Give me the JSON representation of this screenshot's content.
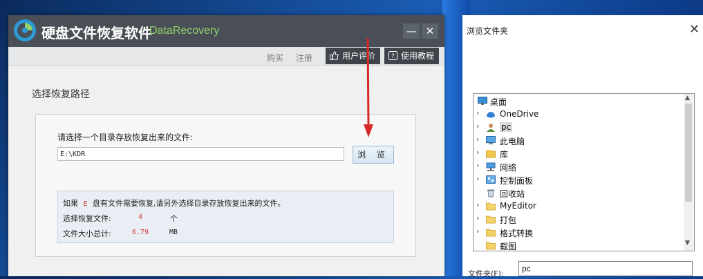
{
  "app": {
    "title_cn": "硬盘文件恢复软件",
    "title_en": "DataRecovery",
    "minimize_symbol": "—",
    "close_symbol": "✕"
  },
  "toolbar": {
    "buy_label": "购买",
    "register_label": "注册",
    "review_label": "用户评价",
    "tutorial_label": "使用教程"
  },
  "main": {
    "section_title": "选择恢复路径",
    "prompt": "请选择一个目录存放恢复出来的文件:",
    "path_value": "E:\\KDR",
    "browse_label": "浏 览",
    "info": {
      "line1_prefix": "如果",
      "drive": "E",
      "line1_suffix": "盘有文件需要恢复,请另外选择目录存放恢复出来的文件。",
      "files_label": "选择恢复文件:",
      "files_count": "4",
      "files_unit": "个",
      "size_label": "文件大小总计:",
      "size_value": "6.79",
      "size_unit": "MB"
    }
  },
  "dialog": {
    "title": "浏览文件夹",
    "close_symbol": "✕",
    "tree": [
      {
        "label": "桌面",
        "icon": "desktop-icon",
        "expandable": false
      },
      {
        "label": "OneDrive",
        "icon": "cloud-icon",
        "expandable": true
      },
      {
        "label": "pc",
        "icon": "user-icon",
        "expandable": true,
        "selected": true
      },
      {
        "label": "此电脑",
        "icon": "computer-icon",
        "expandable": true
      },
      {
        "label": "库",
        "icon": "library-icon",
        "expandable": true
      },
      {
        "label": "网络",
        "icon": "network-icon",
        "expandable": true
      },
      {
        "label": "控制面板",
        "icon": "control-panel-icon",
        "expandable": true
      },
      {
        "label": "回收站",
        "icon": "recycle-bin-icon",
        "expandable": false
      },
      {
        "label": "MyEditor",
        "icon": "folder-icon",
        "expandable": true
      },
      {
        "label": "打包",
        "icon": "folder-icon",
        "expandable": true
      },
      {
        "label": "格式转换",
        "icon": "folder-icon",
        "expandable": true
      },
      {
        "label": "截图",
        "icon": "folder-icon",
        "expandable": false
      }
    ],
    "folder_label": "文件夹(F):",
    "folder_value": "pc"
  },
  "colors": {
    "title_bar": "#4a4f57",
    "accent_green": "#8fd36b",
    "arrow_red": "#d62828",
    "value_red": "#d23b3b"
  }
}
